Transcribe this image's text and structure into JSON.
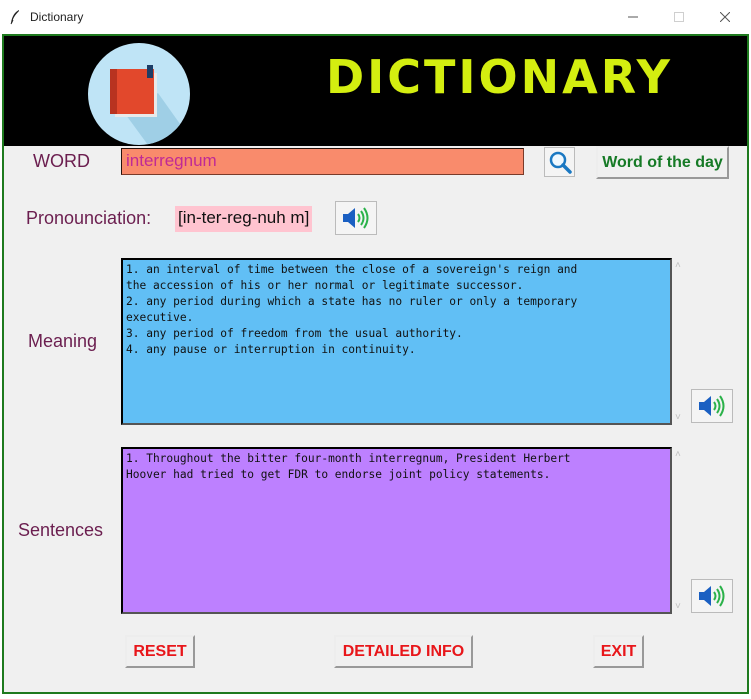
{
  "window": {
    "title": "Dictionary",
    "minimize_icon": "minimize-icon",
    "maximize_icon": "maximize-icon",
    "close_icon": "close-icon"
  },
  "header": {
    "title": "DICTIONARY",
    "logo_icon": "open-book-icon",
    "background": "#000000",
    "title_color": "#d4ee10"
  },
  "word": {
    "label": "WORD",
    "value": "interregnum",
    "input_bg": "#f98b6c",
    "search_icon": "search-magnifier-icon",
    "word_of_day_label": "Word of the day"
  },
  "pronunciation": {
    "label": "Pronounciation:",
    "value": "[in-ter-reg-nuh m]",
    "speaker_icon": "speaker-icon"
  },
  "meaning": {
    "label": "Meaning",
    "text": "1. an interval of time between the close of a sovereign's reign and\nthe accession of his or her normal or legitimate successor.\n2. any period during which a state has no ruler or only a temporary\nexecutive.\n3. any period of freedom from the usual authority.\n4. any pause or interruption in continuity.",
    "bg": "#61bff5"
  },
  "sentences": {
    "label": "Sentences",
    "text": "1. Throughout the bitter four-month interregnum, President Herbert\nHoover had tried to get FDR to endorse joint policy statements.",
    "bg": "#bd80ff"
  },
  "footer": {
    "reset_label": "RESET",
    "detail_label": "DETAILED INFO",
    "exit_label": "EXIT",
    "button_color": "#e8161a"
  },
  "scroll_glyphs": {
    "up": "˄",
    "down": "˅"
  }
}
